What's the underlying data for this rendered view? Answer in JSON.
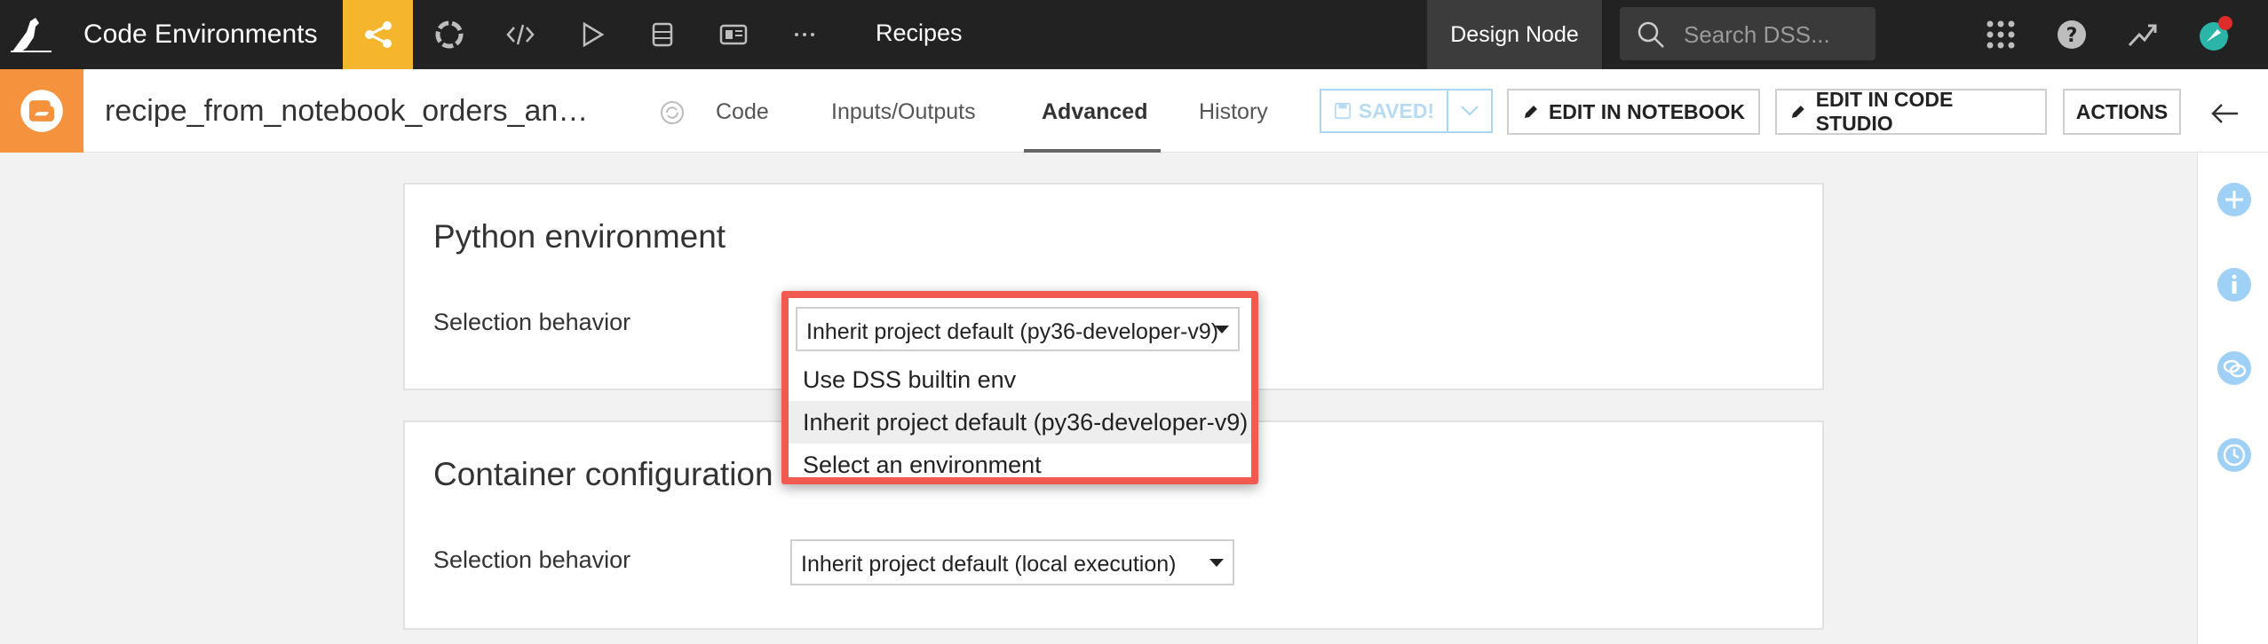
{
  "topbar": {
    "app_title": "Code Environments",
    "nav_current": "Recipes",
    "node_label": "Design Node",
    "search_placeholder": "Search DSS..."
  },
  "recipe": {
    "name": "recipe_from_notebook_orders_an…",
    "tabs": [
      "Code",
      "Inputs/Outputs",
      "Advanced",
      "History"
    ],
    "active_tab": "Advanced",
    "saved_label": "SAVED!",
    "edit_notebook_label": "EDIT IN NOTEBOOK",
    "edit_studio_label": "EDIT IN CODE STUDIO",
    "actions_label": "ACTIONS"
  },
  "python_env": {
    "title": "Python environment",
    "selection_label": "Selection behavior",
    "selected_value": "Inherit project default (py36-developer-v9)",
    "options": [
      "Use DSS builtin env",
      "Inherit project default (py36-developer-v9)",
      "Select an environment"
    ],
    "highlighted_option": "Inherit project default (py36-developer-v9)"
  },
  "container_config": {
    "title": "Container configuration",
    "selection_label": "Selection behavior",
    "selected_value": "Inherit project default (local execution)"
  },
  "colors": {
    "topbar_bg": "#222222",
    "flow_accent": "#f5b52c",
    "python_badge": "#f5923e",
    "highlight_border": "#f05a4f",
    "rail_icon": "#9fd0f5"
  }
}
